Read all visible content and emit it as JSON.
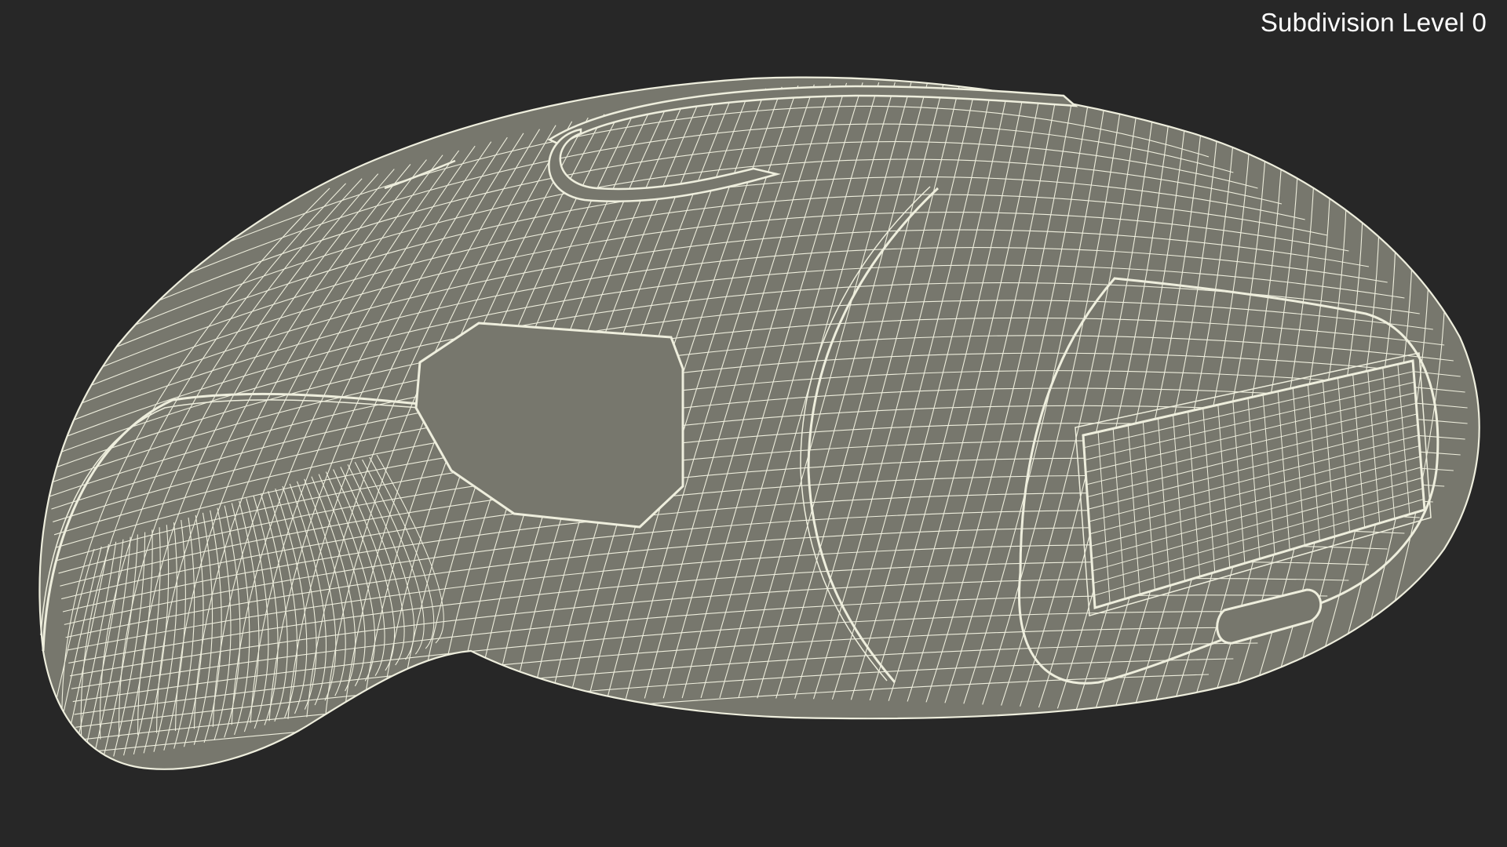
{
  "viewport": {
    "subdivision_label": "Subdivision Level 0"
  },
  "colors": {
    "background": "#272727",
    "surface": "#77776d",
    "wire": "#eeeedd",
    "label": "#ffffff"
  },
  "model": {
    "description_icon": "wireframe-mesh-icon"
  }
}
